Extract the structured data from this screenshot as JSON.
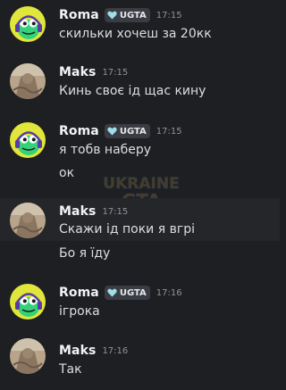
{
  "messages": [
    {
      "author": "Roma",
      "badge": "UGTA",
      "time": "17:15",
      "lines": [
        "скильки хочеш за 20кк"
      ]
    },
    {
      "author": "Maks",
      "time": "17:15",
      "lines": [
        "Кинь своє ід щас кину"
      ]
    },
    {
      "author": "Roma",
      "badge": "UGTA",
      "time": "17:15",
      "lines": [
        "я тобв наберу",
        "ок"
      ]
    },
    {
      "author": "Maks",
      "time": "17:15",
      "lines": [
        "Скажи ід поки я вгрі",
        "Бо я їду"
      ]
    },
    {
      "author": "Roma",
      "badge": "UGTA",
      "time": "17:16",
      "lines": [
        "ігрока"
      ]
    },
    {
      "author": "Maks",
      "time": "17:16",
      "lines": [
        "Так"
      ]
    }
  ],
  "watermark": {
    "line1": "UKRAINE",
    "line2": "GTA"
  },
  "colors": {
    "background": "#1e1f22",
    "hover_background": "#25262a",
    "username": "#f2f3f5",
    "text": "#dbdee1",
    "timestamp": "#8e9297",
    "badge_bg": "#3a3c43",
    "roma_avatar_bg": "#e0e63a",
    "maks_avatar_bg": "#b8a48a"
  },
  "icons": {
    "roma_avatar": "green-frog-headphones-avatar",
    "maks_avatar": "photo-avatar",
    "badge_icon": "heart-icon"
  }
}
